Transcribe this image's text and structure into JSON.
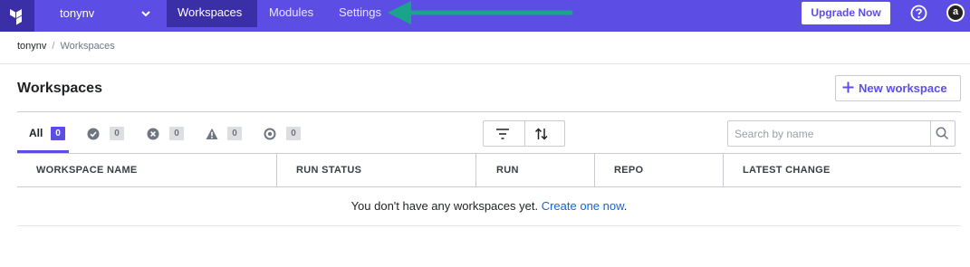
{
  "nav": {
    "org_name": "tonynv",
    "links": [
      "Workspaces",
      "Modules",
      "Settings"
    ],
    "upgrade_label": "Upgrade Now",
    "avatar_letter": "a"
  },
  "breadcrumb": {
    "org": "tonynv",
    "separator": "/",
    "current": "Workspaces"
  },
  "header": {
    "title": "Workspaces",
    "new_workspace_label": "New workspace"
  },
  "filters": {
    "all_label": "All",
    "all_count": "0",
    "status_counts": [
      {
        "icon": "check-circle-icon",
        "count": "0"
      },
      {
        "icon": "x-circle-icon",
        "count": "0"
      },
      {
        "icon": "warning-icon",
        "count": "0"
      },
      {
        "icon": "dot-circle-icon",
        "count": "0"
      }
    ]
  },
  "search": {
    "placeholder": "Search by name",
    "value": ""
  },
  "table": {
    "columns": [
      "WORKSPACE NAME",
      "RUN STATUS",
      "RUN",
      "REPO",
      "LATEST CHANGE"
    ],
    "empty_message": "You don't have any workspaces yet.",
    "empty_link": "Create one now",
    "empty_suffix": "."
  },
  "colors": {
    "brand": "#5c4ee5",
    "brand_dark": "#3b2fa8",
    "annotation_arrow": "#1aa58a",
    "link": "#1563d6"
  }
}
